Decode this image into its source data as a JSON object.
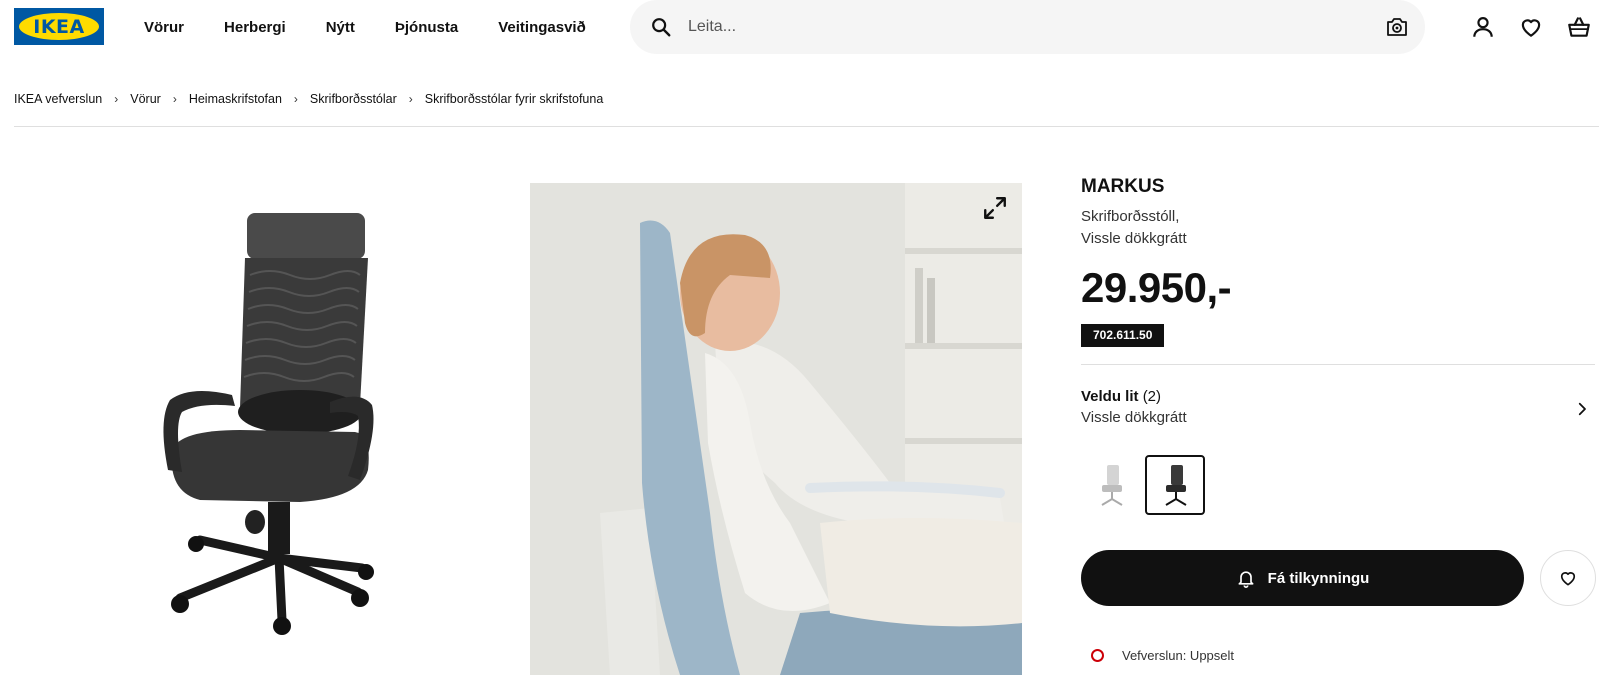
{
  "logo": {
    "text": "IKEA"
  },
  "nav": {
    "items": [
      "Vörur",
      "Herbergi",
      "Nýtt",
      "Þjónusta",
      "Veitingasvið"
    ]
  },
  "search": {
    "placeholder": "Leita..."
  },
  "breadcrumb": [
    "IKEA vefverslun",
    "Vörur",
    "Heimaskrifstofan",
    "Skrifborðsstólar",
    "Skrifborðsstólar fyrir skrifstofuna"
  ],
  "product": {
    "name": "MARKUS",
    "type_line1": "Skrifborðsstóll,",
    "type_line2": "Vissle dökkgrátt",
    "price": "29.950,-",
    "article_number": "702.611.50"
  },
  "color": {
    "label": "Veldu lit",
    "count": "(2)",
    "selected": "Vissle dökkgrátt",
    "swatches": [
      {
        "name": "light-grey",
        "selected": false
      },
      {
        "name": "dark-grey",
        "selected": true
      }
    ]
  },
  "actions": {
    "notify_label": "Fá tilkynningu"
  },
  "stock": {
    "text": "Vefverslun: Uppselt",
    "status_color": "#cc0008"
  },
  "colors": {
    "brand_blue": "#0058a3",
    "brand_yellow": "#ffdb00",
    "button_dark": "#111111"
  }
}
